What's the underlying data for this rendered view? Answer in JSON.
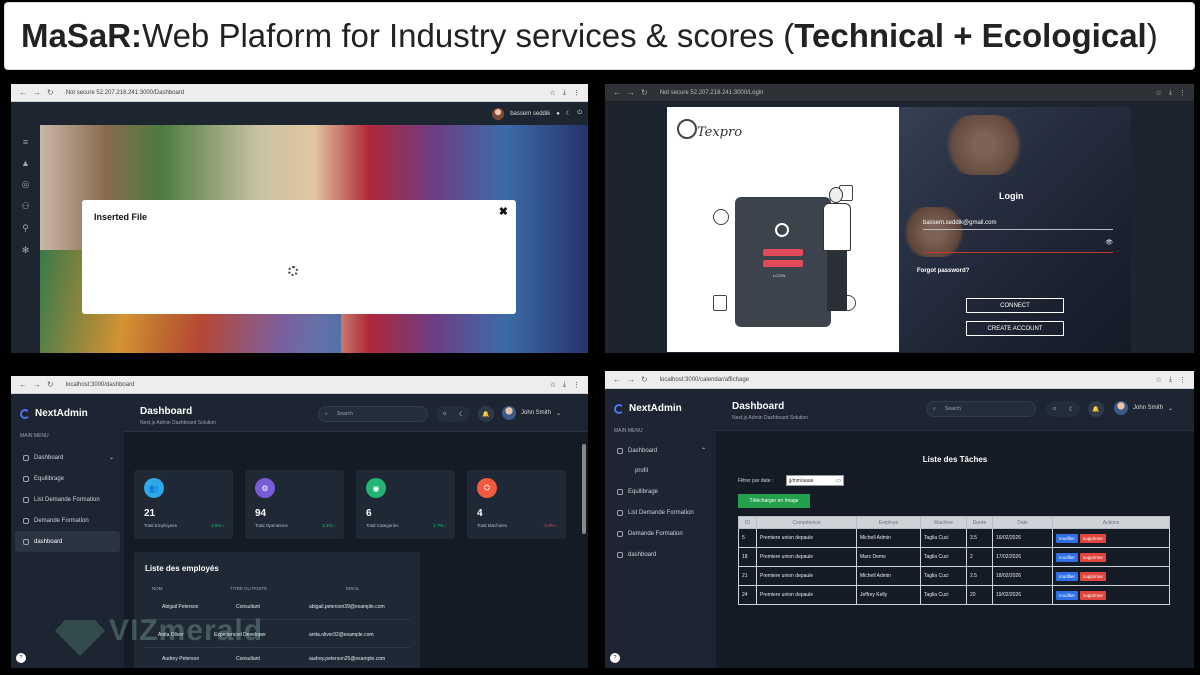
{
  "banner": {
    "brand": "MaSaR:",
    "mid": " Web Plaform for Industry services & scores (",
    "tech": "Technical + Ecological",
    "close": ")"
  },
  "panelA": {
    "url": "Not secure   52.207.216.241:3000/Dashboard",
    "user": "bassem seddik",
    "modal_title": "Inserted File",
    "close": "✖"
  },
  "panelB": {
    "url": "Not secure   52.207.216.241:3000/Login",
    "logo": "Texpro",
    "login_title": "Login",
    "email": "bassem.seddik@gmail.com",
    "forgot": "Forgot password?",
    "connect": "CONNECT",
    "create": "CREATE ACCOUNT",
    "phone_btn": "LOGIN"
  },
  "panelC": {
    "url": "localhost:3000/dashboard",
    "brand": "NextAdmin",
    "menu_header": "MAIN MENU",
    "menu": [
      "Dashboard",
      "Equilibrage",
      "List Demande Formation",
      "Demande Formation",
      "dashboard"
    ],
    "title": "Dashboard",
    "subtitle": "Next.js Admin Dashboard Solution",
    "search": "Search",
    "user": "John Smith",
    "cards": [
      {
        "value": "21",
        "label": "Total Employees",
        "pct": "2.5% ↑",
        "color": "#2ea8e6",
        "pct_color": "#22c55e"
      },
      {
        "value": "94",
        "label": "Total Operations",
        "pct": "3.1% ↑",
        "color": "#7c5cd6",
        "pct_color": "#22c55e"
      },
      {
        "value": "6",
        "label": "Total Categories",
        "pct": "1.7% ↑",
        "color": "#22b573",
        "pct_color": "#22c55e"
      },
      {
        "value": "4",
        "label": "Total Machines",
        "pct": "-4.3% ↓",
        "color": "#f15a3c",
        "pct_color": "#ef4444"
      }
    ],
    "employees_title": "Liste des employés",
    "employees_headers": [
      "NOM",
      "TITRE DU POSTE",
      "EMAIL"
    ],
    "employees": [
      {
        "name": "Abigail Peterson",
        "title": "Consultant",
        "email": "abigail.peterson39@example.com"
      },
      {
        "name": "Anita Oliver",
        "title": "Experienced Developer",
        "email": "anita.oliver32@example.com"
      },
      {
        "name": "Audrey Peterson",
        "title": "Consultant",
        "email": "audrey.peterson25@example.com"
      }
    ],
    "watermark": "VIZmerald"
  },
  "panelD": {
    "url": "localhost:3000/calendar/affichage",
    "brand": "NextAdmin",
    "menu_header": "MAIN MENU",
    "menu": [
      "Dashboard",
      "profil",
      "Equilibrage",
      "List Demande Formation",
      "Demande Formation",
      "dashboard"
    ],
    "title": "Dashboard",
    "subtitle": "Next.js Admin Dashboard Solution",
    "search": "Search",
    "user": "John Smith",
    "tasks_title": "Liste des Tâches",
    "filter_label": "Filtrer par date :",
    "date_placeholder": "jj/mm/aaaa",
    "download": "Télécharger en Image",
    "table_headers": [
      "ID",
      "Compétence",
      "Employé",
      "Machine",
      "Durée",
      "Date",
      "Actions"
    ],
    "rows": [
      [
        "5",
        "Premiere union depaule",
        "Michell Admin",
        "Taglia Cuci",
        "3.5",
        "16/02/2026"
      ],
      [
        "18",
        "Premiere union depaule",
        "Marc Demo",
        "Taglia Cuci",
        "2",
        "17/02/2026"
      ],
      [
        "21",
        "Premiere union depaule",
        "Michell Admin",
        "Taglia Cuci",
        "2.5",
        "18/02/2026"
      ],
      [
        "24",
        "Premiere union depaule",
        "Jeffrey Kelly",
        "Taglia Cuci",
        "20",
        "19/02/2026"
      ]
    ],
    "btn_modify": "modifier",
    "btn_delete": "supprimer"
  }
}
